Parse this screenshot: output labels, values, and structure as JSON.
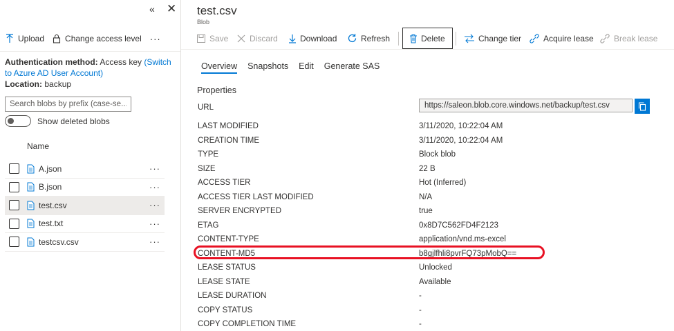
{
  "left_panel": {
    "collapse_glyph": "«",
    "close_glyph": "✕",
    "toolbar": {
      "upload_label": "Upload",
      "change_access_label": "Change access level",
      "more_label": "···"
    },
    "auth": {
      "method_label": "Authentication method:",
      "method_value": "Access key",
      "switch_link": "(Switch to Azure AD User Account)",
      "location_label": "Location:",
      "location_value": "backup"
    },
    "search": {
      "placeholder": "Search blobs by prefix (case-se..."
    },
    "show_deleted_label": "Show deleted blobs",
    "list": {
      "header": "Name",
      "more_glyph": "···",
      "items": [
        {
          "name": "A.json"
        },
        {
          "name": "B.json"
        },
        {
          "name": "test.csv"
        },
        {
          "name": "test.txt"
        },
        {
          "name": "testcsv.csv"
        }
      ]
    }
  },
  "blob": {
    "title": "test.csv",
    "subtitle": "Blob"
  },
  "toolbar": {
    "save_label": "Save",
    "discard_label": "Discard",
    "download_label": "Download",
    "refresh_label": "Refresh",
    "delete_label": "Delete",
    "change_tier_label": "Change tier",
    "acquire_lease_label": "Acquire lease",
    "break_lease_label": "Break lease"
  },
  "tabs": [
    {
      "label": "Overview"
    },
    {
      "label": "Snapshots"
    },
    {
      "label": "Edit"
    },
    {
      "label": "Generate SAS"
    }
  ],
  "properties_heading": "Properties",
  "properties": {
    "url_label": "URL",
    "url_value": "https://saleon.blob.core.windows.net/backup/test.csv",
    "rows": [
      {
        "key": "LAST MODIFIED",
        "value": "3/11/2020, 10:22:04 AM"
      },
      {
        "key": "CREATION TIME",
        "value": "3/11/2020, 10:22:04 AM"
      },
      {
        "key": "TYPE",
        "value": "Block blob"
      },
      {
        "key": "SIZE",
        "value": "22 B"
      },
      {
        "key": "ACCESS TIER",
        "value": "Hot (Inferred)"
      },
      {
        "key": "ACCESS TIER LAST MODIFIED",
        "value": "N/A"
      },
      {
        "key": "SERVER ENCRYPTED",
        "value": "true"
      },
      {
        "key": "ETAG",
        "value": "0x8D7C562FD4F2123"
      },
      {
        "key": "CONTENT-TYPE",
        "value": "application/vnd.ms-excel"
      },
      {
        "key": "CONTENT-MD5",
        "value": "b8gjlfhli8pvrFQ73pMobQ=="
      },
      {
        "key": "LEASE STATUS",
        "value": "Unlocked"
      },
      {
        "key": "LEASE STATE",
        "value": "Available"
      },
      {
        "key": "LEASE DURATION",
        "value": "-"
      },
      {
        "key": "COPY STATUS",
        "value": "-"
      },
      {
        "key": "COPY COMPLETION TIME",
        "value": "-"
      }
    ]
  },
  "colors": {
    "accent": "#0078d4",
    "highlight": "#e81123",
    "text": "#323130",
    "disabled": "#a19f9d"
  }
}
